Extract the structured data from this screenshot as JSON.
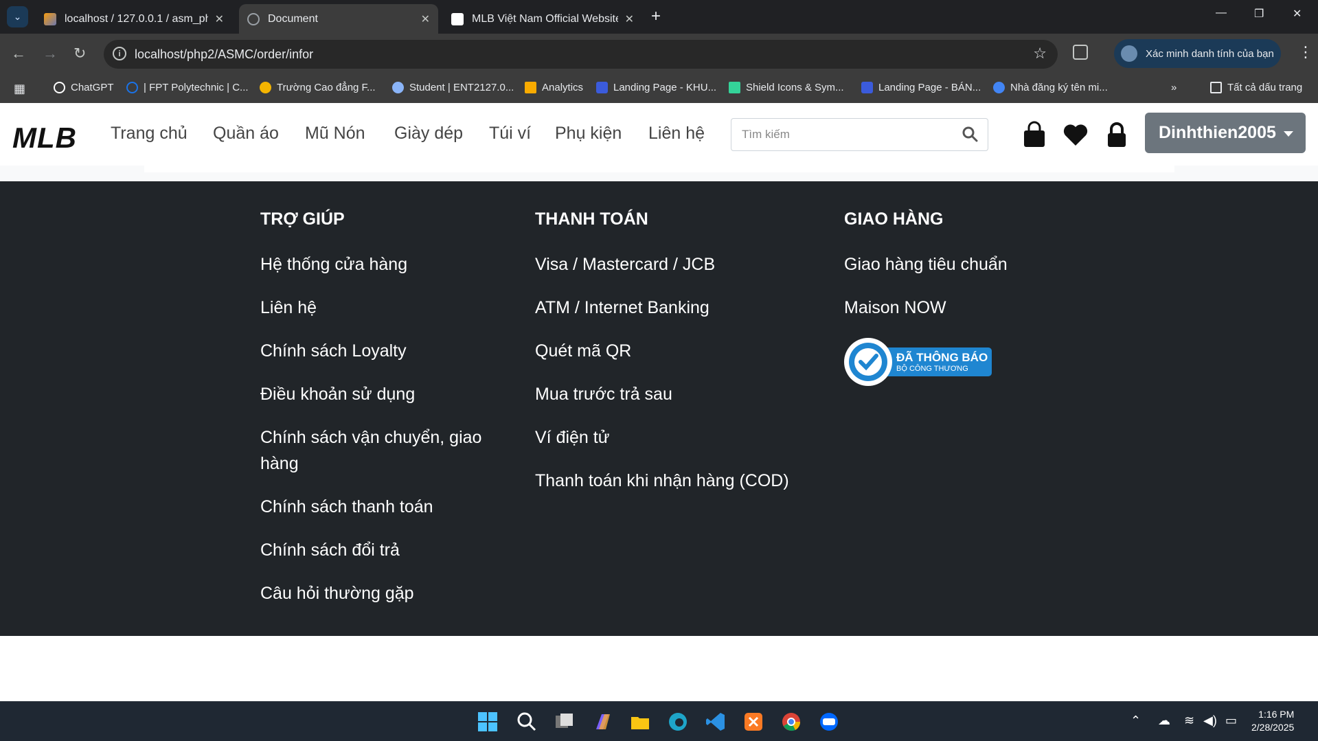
{
  "browser": {
    "tabs": [
      {
        "title": "localhost / 127.0.0.1 / asm_php2",
        "active": false
      },
      {
        "title": "Document",
        "active": true
      },
      {
        "title": "MLB Việt Nam Official Website",
        "active": false
      }
    ],
    "address": "localhost/php2/ASMC/order/infor",
    "profile_label": "Xác minh danh tính của bạn",
    "bookmarks": [
      "ChatGPT",
      "| FPT Polytechnic | C...",
      "Trường Cao đẳng F...",
      "Student | ENT2127.0...",
      "Analytics",
      "Landing Page - KHU...",
      "Shield Icons & Sym...",
      "Landing Page - BÁN...",
      "Nhà đăng ký tên mi..."
    ],
    "bookmarks_overflow": "»",
    "all_bookmarks": "Tất cả dấu trang"
  },
  "site": {
    "logo": "MLB",
    "nav": [
      "Trang chủ",
      "Quần áo",
      "Mũ Nón",
      "Giày dép",
      "Túi ví",
      "Phụ kiện",
      "Liên hệ"
    ],
    "search_placeholder": "Tìm kiếm",
    "user": "Dinhthien2005"
  },
  "footer": {
    "help": {
      "title": "TRỢ GIÚP",
      "items": [
        "Hệ thống cửa hàng",
        "Liên hệ",
        "Chính sách Loyalty",
        "Điều khoản sử dụng",
        "Chính sách vận chuyển, giao hàng",
        "Chính sách thanh toán",
        "Chính sách đổi trả",
        "Câu hỏi thường gặp"
      ]
    },
    "payment": {
      "title": "THANH TOÁN",
      "items": [
        "Visa / Mastercard / JCB",
        "ATM / Internet Banking",
        "Quét mã QR",
        "Mua trước trả sau",
        "Ví điện tử",
        "Thanh toán khi nhận hàng (COD)"
      ]
    },
    "shipping": {
      "title": "GIAO HÀNG",
      "items": [
        "Giao hàng tiêu chuẩn",
        "Maison NOW"
      ],
      "badge_line1": "ĐÃ THÔNG BÁO",
      "badge_line2": "BỘ CÔNG THƯƠNG"
    }
  },
  "taskbar": {
    "time": "1:16 PM",
    "date": "2/28/2025"
  }
}
